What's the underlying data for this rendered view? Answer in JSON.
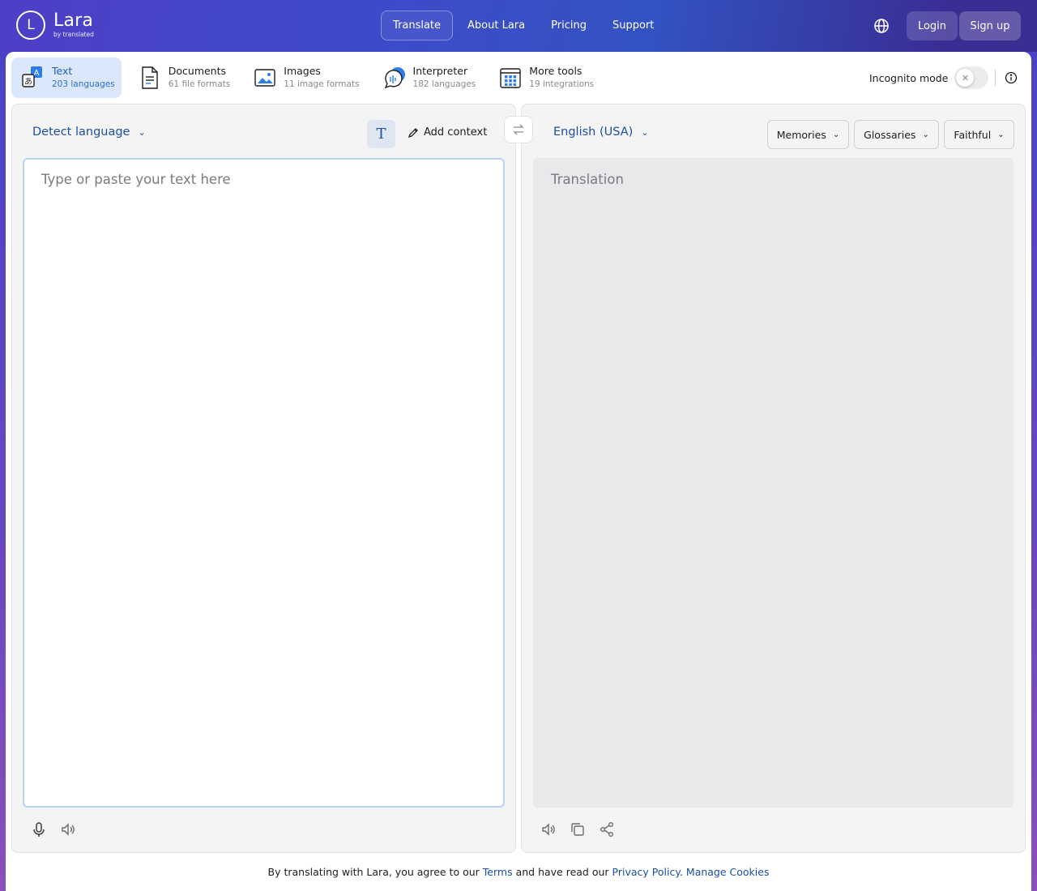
{
  "brand": {
    "name": "Lara",
    "sub": "by translated",
    "mark": "L"
  },
  "nav": [
    "Translate",
    "About Lara",
    "Pricing",
    "Support"
  ],
  "auth": {
    "login": "Login",
    "signup": "Sign up"
  },
  "tabs": [
    {
      "title": "Text",
      "sub": "203 languages",
      "icon": "text-translate-icon"
    },
    {
      "title": "Documents",
      "sub": "61 file formats",
      "icon": "document-icon"
    },
    {
      "title": "Images",
      "sub": "11 image formats",
      "icon": "image-icon"
    },
    {
      "title": "Interpreter",
      "sub": "182 languages",
      "icon": "interpreter-icon"
    },
    {
      "title": "More tools",
      "sub": "19 integrations",
      "icon": "grid-tools-icon"
    }
  ],
  "incognito": {
    "label": "Incognito mode",
    "enabled": false
  },
  "source": {
    "language": "Detect language",
    "format_glyph": "T",
    "add_context": "Add context",
    "placeholder": "Type or paste your text here"
  },
  "target": {
    "language": "English (USA)",
    "placeholder": "Translation",
    "dropdowns": [
      "Memories",
      "Glossaries",
      "Faithful"
    ]
  },
  "footer": {
    "prefix": "By translating with Lara, you agree to our",
    "terms": "Terms",
    "middle": "and have read our",
    "privacy": "Privacy Policy",
    "cookies": "Manage Cookies"
  },
  "colors": {
    "accent": "#1c4fa0",
    "active_tab_bg": "#dbe8fb",
    "header_start": "#4d3fc6",
    "header_end": "#3a2f8e"
  }
}
